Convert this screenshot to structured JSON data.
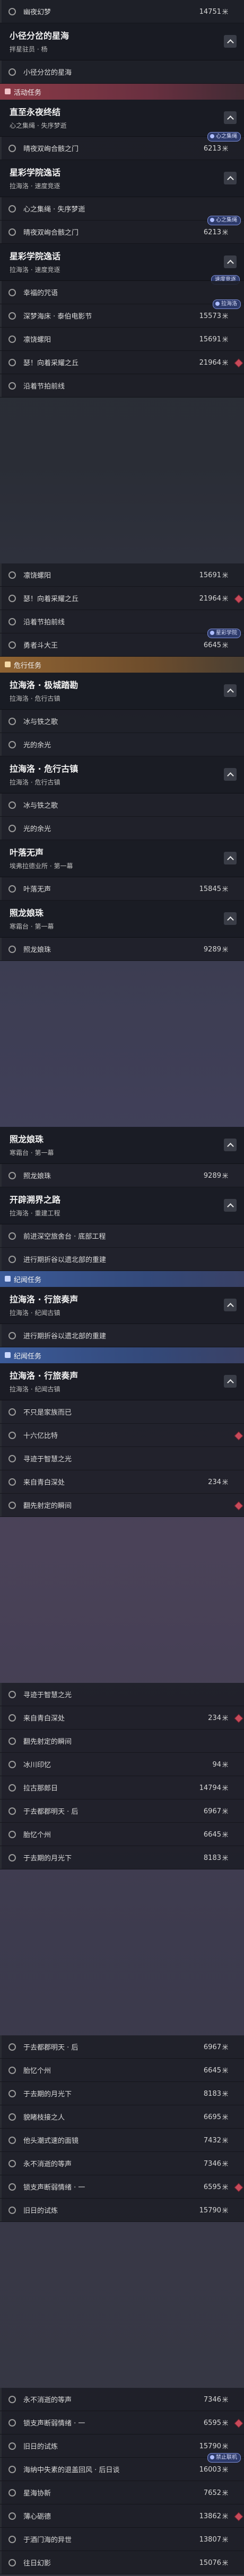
{
  "rows": [
    {
      "kind": "item",
      "label": "幽夜幻梦",
      "dist": "14751",
      "unit": "米"
    },
    {
      "kind": "group",
      "title": "小径分岔的星海",
      "sub": "拌星驻员 · 杨"
    },
    {
      "kind": "item",
      "label": "小径分岔的星海"
    },
    {
      "kind": "cat",
      "style": "red",
      "label": "活动任务"
    },
    {
      "kind": "group",
      "title": "直至永夜终结",
      "sub": "心之集绳 · 失序梦逝"
    },
    {
      "kind": "item",
      "label": "晴夜双峋合骸之门",
      "dist": "6213",
      "unit": "米",
      "chip": "心之集绳"
    },
    {
      "kind": "group",
      "title": "星彩学院逸话",
      "sub": "拉海洛 · 速度竞逐"
    },
    {
      "kind": "item",
      "label": "心之集绳 · 失序梦逝",
      "dist": ""
    },
    {
      "kind": "item",
      "label": "晴夜双峋合骸之门",
      "dist": "6213",
      "unit": "米",
      "chip": "心之集绳"
    },
    {
      "kind": "group",
      "title": "星彩学院逸话",
      "sub": "拉海洛 · 速度竞逐",
      "chip": "速度竞逐"
    },
    {
      "kind": "item",
      "label": "幸福的咒语"
    },
    {
      "kind": "item",
      "label": "深梦海床 · 泰伯电影节",
      "dist": "15573",
      "unit": "米",
      "chip": "拉海洛"
    },
    {
      "kind": "item",
      "label": "凛饶螺阳",
      "dist": "15691",
      "unit": "米"
    },
    {
      "kind": "item",
      "label": "瑟！向着采耀之丘",
      "dist": "21964",
      "unit": "米",
      "marker": true
    },
    {
      "kind": "item",
      "label": "沿着节拍前线"
    },
    {
      "kind": "gap"
    },
    {
      "kind": "item",
      "label": "凛饶螺阳",
      "dist": "15691",
      "unit": "米"
    },
    {
      "kind": "item",
      "label": "瑟！向着采耀之丘",
      "dist": "21964",
      "unit": "米",
      "marker": true
    },
    {
      "kind": "item",
      "label": "沿着节拍前线"
    },
    {
      "kind": "item",
      "label": "勇者斗大王",
      "dist": "6645",
      "unit": "米",
      "chip": "星彩学院"
    },
    {
      "kind": "cat",
      "style": "orange",
      "label": "危行任务"
    },
    {
      "kind": "group",
      "title": "拉海洛 · 极城踏勘",
      "sub": "拉海洛 · 危行古镇"
    },
    {
      "kind": "item",
      "label": "冰与铁之歌"
    },
    {
      "kind": "item",
      "label": "光的余光"
    },
    {
      "kind": "group",
      "title": "拉海洛 · 危行古镇",
      "sub": "拉海洛 · 危行古镇"
    },
    {
      "kind": "item",
      "label": "冰与铁之歌"
    },
    {
      "kind": "item",
      "label": "光的余光"
    },
    {
      "kind": "group",
      "title": "叶落无声",
      "sub": "埃弗拉德业所 · 第一幕"
    },
    {
      "kind": "item",
      "label": "叶落无声",
      "dist": "15845",
      "unit": "米"
    },
    {
      "kind": "group",
      "title": "照龙娘珠",
      "sub": "寒霜台 · 第一幕"
    },
    {
      "kind": "item",
      "label": "照龙娘珠",
      "dist": "9289",
      "unit": "米"
    },
    {
      "kind": "gap"
    },
    {
      "kind": "group",
      "title": "照龙娘珠",
      "sub": "寒霜台 · 第一幕"
    },
    {
      "kind": "item",
      "label": "照龙娘珠",
      "dist": "9289",
      "unit": "米"
    },
    {
      "kind": "group",
      "title": "开辟溯界之路",
      "sub": "拉海洛 · 重建工程"
    },
    {
      "kind": "item",
      "label": "前进深空旅舍台 · 底部工程"
    },
    {
      "kind": "item",
      "label": "进行期折谷以遗北部的重建"
    },
    {
      "kind": "cat",
      "style": "blue",
      "label": "纪闻任务"
    },
    {
      "kind": "group",
      "title": "拉海洛 · 行旅奏声",
      "sub": "拉海洛 · 纪闻古镇"
    },
    {
      "kind": "item",
      "label": "进行期折谷以遗北部的重建"
    },
    {
      "kind": "cat",
      "style": "blue",
      "label": "纪闻任务"
    },
    {
      "kind": "group",
      "title": "拉海洛 · 行旅奏声",
      "sub": "拉海洛 · 纪闻古镇"
    },
    {
      "kind": "item",
      "label": "不只是家族而已"
    },
    {
      "kind": "item",
      "label": "十六亿比特",
      "marker": true
    },
    {
      "kind": "item",
      "label": "寻迹于智慧之光"
    },
    {
      "kind": "item",
      "label": "来自青白深处",
      "dist": "234",
      "unit": "米"
    },
    {
      "kind": "item",
      "label": "翻先射定的瞬间",
      "marker": true
    },
    {
      "kind": "gap"
    },
    {
      "kind": "item",
      "label": "寻迹于智慧之光"
    },
    {
      "kind": "item",
      "label": "来自青白深处",
      "dist": "234",
      "unit": "米",
      "marker": true
    },
    {
      "kind": "item",
      "label": "翻先射定的瞬间"
    },
    {
      "kind": "item",
      "label": "冰川印忆",
      "dist": "94",
      "unit": "米"
    },
    {
      "kind": "item",
      "label": "拉古那郎日",
      "dist": "14794",
      "unit": "米"
    },
    {
      "kind": "item",
      "label": "于去都郡明天 · 后",
      "dist": "6967",
      "unit": "米"
    },
    {
      "kind": "item",
      "label": "胎忆个州",
      "dist": "6645",
      "unit": "米"
    },
    {
      "kind": "item",
      "label": "于去期的月光下",
      "dist": "8183",
      "unit": "米"
    },
    {
      "kind": "gap"
    },
    {
      "kind": "item",
      "label": "于去都郡明天 · 后",
      "dist": "6967",
      "unit": "米"
    },
    {
      "kind": "item",
      "label": "胎忆个州",
      "dist": "6645",
      "unit": "米"
    },
    {
      "kind": "item",
      "label": "于去期的月光下",
      "dist": "8183",
      "unit": "米"
    },
    {
      "kind": "item",
      "label": "貌睹枝接之人",
      "dist": "6695",
      "unit": "米"
    },
    {
      "kind": "item",
      "label": "他头潮式速的面镜",
      "dist": "7432",
      "unit": "米"
    },
    {
      "kind": "item",
      "label": "永不消逝的等声",
      "dist": "7346",
      "unit": "米"
    },
    {
      "kind": "item",
      "label": "锁支声断弱情绪 · 一",
      "dist": "6595",
      "unit": "米",
      "marker": true
    },
    {
      "kind": "item",
      "label": "旧日的试炼",
      "dist": "15790",
      "unit": "米"
    },
    {
      "kind": "gap"
    },
    {
      "kind": "item",
      "label": "永不消逝的等声",
      "dist": "7346",
      "unit": "米"
    },
    {
      "kind": "item",
      "label": "锁支声断弱情绪 · 一",
      "dist": "6595",
      "unit": "米",
      "marker": true
    },
    {
      "kind": "item",
      "label": "旧日的试炼",
      "dist": "15790",
      "unit": "米"
    },
    {
      "kind": "item",
      "label": "海纳中失素的退盖回风 · 后日谈",
      "dist": "16003",
      "unit": "米",
      "chip": "禁止联机"
    },
    {
      "kind": "item",
      "label": "星海协新",
      "dist": "7652",
      "unit": "米"
    },
    {
      "kind": "item",
      "label": "薄心砺德",
      "dist": "13862",
      "unit": "米",
      "marker": true
    },
    {
      "kind": "item",
      "label": "于酒门海的异世",
      "dist": "13807",
      "unit": "米"
    },
    {
      "kind": "item",
      "label": "往日幻影",
      "dist": "15076",
      "unit": "米"
    }
  ]
}
